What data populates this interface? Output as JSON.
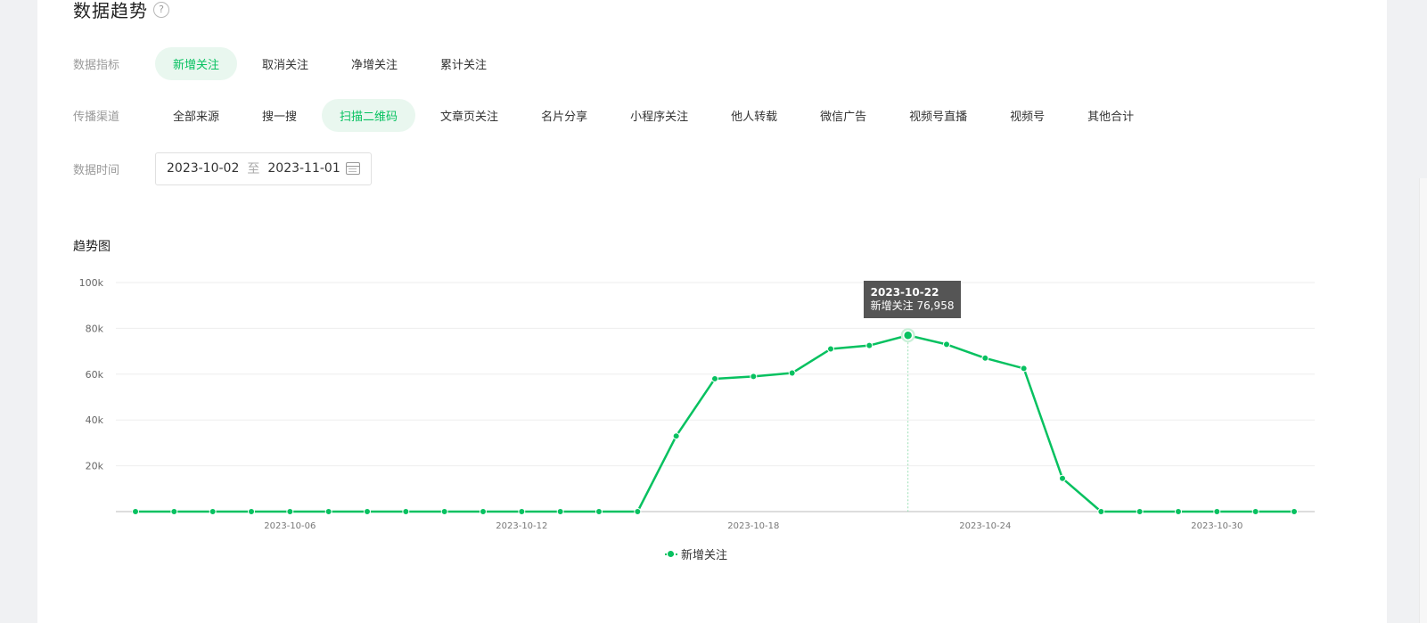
{
  "page_title": "数据趋势",
  "help_icon": "?",
  "metric": {
    "label": "数据指标",
    "options": [
      "新增关注",
      "取消关注",
      "净增关注",
      "累计关注"
    ],
    "active_index": 0
  },
  "channel": {
    "label": "传播渠道",
    "options": [
      "全部来源",
      "搜一搜",
      "扫描二维码",
      "文章页关注",
      "名片分享",
      "小程序关注",
      "他人转载",
      "微信广告",
      "视频号直播",
      "视频号",
      "其他合计"
    ],
    "active_index": 2
  },
  "date": {
    "label": "数据时间",
    "start": "2023-10-02",
    "separator": "至",
    "end": "2023-11-01"
  },
  "chart_section_title": "趋势图",
  "tooltip": {
    "date": "2023-10-22",
    "text": "新增关注 76,958"
  },
  "colors": {
    "accent": "#07c160",
    "active_chip_bg": "#e9f7ef"
  },
  "chart_data": {
    "type": "line",
    "title": "",
    "xlabel": "",
    "ylabel": "",
    "ylim": [
      0,
      100000
    ],
    "y_ticks": [
      "20k",
      "40k",
      "60k",
      "80k",
      "100k"
    ],
    "x_tick_labels": [
      "2023-10-06",
      "2023-10-12",
      "2023-10-18",
      "2023-10-24",
      "2023-10-30"
    ],
    "x": [
      "2023-10-02",
      "2023-10-03",
      "2023-10-04",
      "2023-10-05",
      "2023-10-06",
      "2023-10-07",
      "2023-10-08",
      "2023-10-09",
      "2023-10-10",
      "2023-10-11",
      "2023-10-12",
      "2023-10-13",
      "2023-10-14",
      "2023-10-15",
      "2023-10-16",
      "2023-10-17",
      "2023-10-18",
      "2023-10-19",
      "2023-10-20",
      "2023-10-21",
      "2023-10-22",
      "2023-10-23",
      "2023-10-24",
      "2023-10-25",
      "2023-10-26",
      "2023-10-27",
      "2023-10-28",
      "2023-10-29",
      "2023-10-30",
      "2023-10-31",
      "2023-11-01"
    ],
    "series": [
      {
        "name": "新增关注",
        "values": [
          0,
          0,
          0,
          0,
          0,
          0,
          0,
          0,
          0,
          0,
          0,
          0,
          0,
          0,
          33000,
          58000,
          59000,
          60500,
          71000,
          72500,
          76958,
          73000,
          67000,
          62500,
          14500,
          0,
          0,
          0,
          0,
          0,
          0
        ]
      }
    ],
    "grid": true,
    "legend_position": "bottom-center"
  }
}
